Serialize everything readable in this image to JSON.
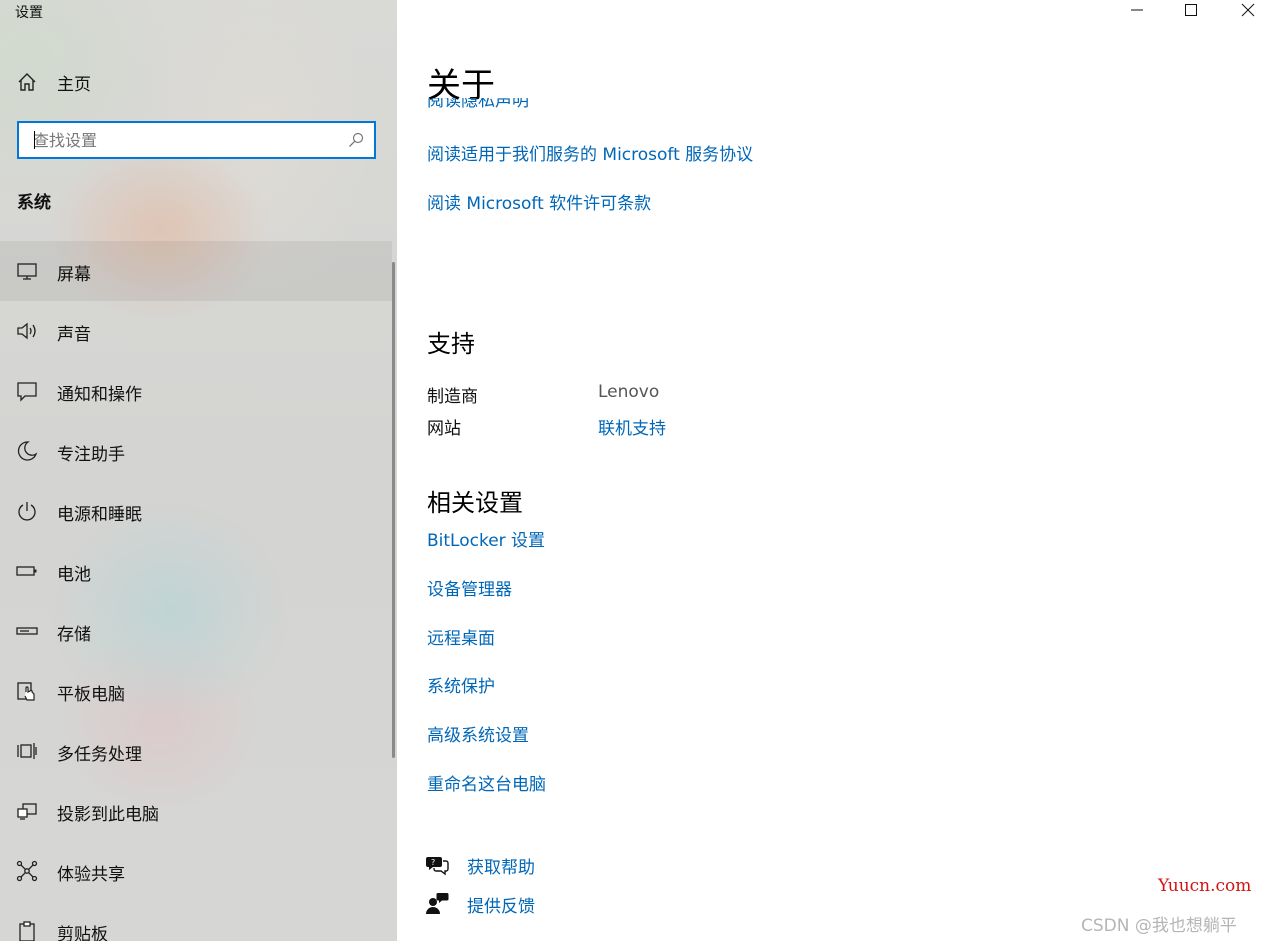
{
  "window": {
    "title": "设置",
    "controls": [
      "minimize",
      "maximize",
      "close"
    ]
  },
  "sidebar": {
    "home_label": "主页",
    "search_placeholder": "查找设置",
    "search_value": "",
    "section_title": "系统",
    "items": [
      {
        "label": "屏幕",
        "icon": "monitor-icon",
        "selected": true
      },
      {
        "label": "声音",
        "icon": "speaker-icon"
      },
      {
        "label": "通知和操作",
        "icon": "notification-icon"
      },
      {
        "label": "专注助手",
        "icon": "moon-icon"
      },
      {
        "label": "电源和睡眠",
        "icon": "power-icon"
      },
      {
        "label": "电池",
        "icon": "battery-icon"
      },
      {
        "label": "存储",
        "icon": "storage-icon"
      },
      {
        "label": "平板电脑",
        "icon": "tablet-icon"
      },
      {
        "label": "多任务处理",
        "icon": "multitasking-icon"
      },
      {
        "label": "投影到此电脑",
        "icon": "project-icon"
      },
      {
        "label": "体验共享",
        "icon": "share-icon"
      },
      {
        "label": "剪贴板",
        "icon": "clipboard-icon"
      }
    ]
  },
  "main": {
    "title": "关于",
    "partial_link": "阅读隐私声明",
    "links_top": [
      "阅读适用于我们服务的 Microsoft 服务协议",
      "阅读 Microsoft 软件许可条款"
    ],
    "support": {
      "heading": "支持",
      "manufacturer_label": "制造商",
      "manufacturer_value": "Lenovo",
      "website_label": "网站",
      "website_link": "联机支持"
    },
    "related": {
      "heading": "相关设置",
      "links": [
        "BitLocker 设置",
        "设备管理器",
        "远程桌面",
        "系统保护",
        "高级系统设置",
        "重命名这台电脑"
      ]
    },
    "help": {
      "get_help": "获取帮助",
      "feedback": "提供反馈"
    }
  },
  "watermarks": {
    "site": "Yuucn.com",
    "csdn": "CSDN @我也想躺平"
  },
  "colors": {
    "accent": "#0078d7",
    "link": "#0067b8",
    "watermark_red": "#d21414"
  }
}
